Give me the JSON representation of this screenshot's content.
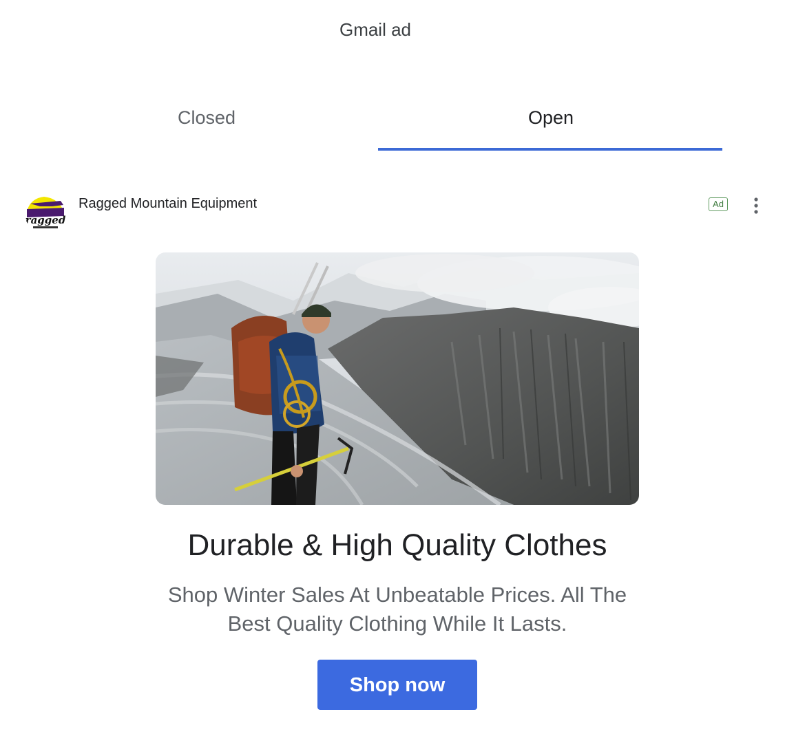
{
  "page": {
    "title": "Gmail ad"
  },
  "tabs": [
    {
      "label": "Closed",
      "selected": false
    },
    {
      "label": "Open",
      "selected": true
    }
  ],
  "ad": {
    "advertiser": "Ragged Mountain Equipment",
    "logo_text": "ragged",
    "badge": "Ad",
    "menu_icon": "more-vert-icon",
    "headline": "Durable & High Quality Clothes",
    "description": "Shop Winter Sales At Unbeatable Prices. All The Best Quality Clothing While It Lasts.",
    "cta_label": "Shop now"
  },
  "colors": {
    "accent": "#3c6ad6",
    "cta_background": "#3c6ae0",
    "ad_badge": "#3f7b3f",
    "logo_purple": "#4a1a6e",
    "logo_yellow": "#f3e600"
  }
}
